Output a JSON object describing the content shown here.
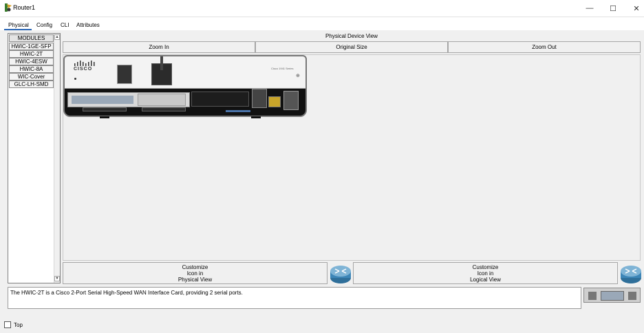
{
  "window": {
    "title": "Router1",
    "controls": {
      "minimize": "—",
      "maximize": "☐",
      "close": "✕"
    }
  },
  "tabs": [
    {
      "label": "Physical",
      "active": true
    },
    {
      "label": "Config",
      "active": false
    },
    {
      "label": "CLI",
      "active": false
    },
    {
      "label": "Attributes",
      "active": false
    }
  ],
  "modules": {
    "header": "MODULES",
    "items": [
      "HWIC-1GE-SFP",
      "HWIC-2T",
      "HWIC-4ESW",
      "HWIC-8A",
      "WIC-Cover",
      "GLC-LH-SMD"
    ]
  },
  "device_view": {
    "title": "Physical Device View",
    "zoom_in": "Zoom In",
    "original_size": "Original Size",
    "zoom_out": "Zoom Out",
    "router_brand": "CISCO",
    "router_model": "Cisco 1941 Series"
  },
  "customize": {
    "physical": [
      "Customize",
      "Icon in",
      "Physical View"
    ],
    "logical": [
      "Customize",
      "Icon in",
      "Logical View"
    ]
  },
  "description": "The HWIC-2T is a Cisco 2-Port Serial High-Speed WAN Interface Card, providing 2 serial ports.",
  "footer": {
    "top_label": "Top",
    "top_checked": false
  },
  "colors": {
    "accent": "#2a66b5",
    "router_icon": "#3d86b8"
  }
}
